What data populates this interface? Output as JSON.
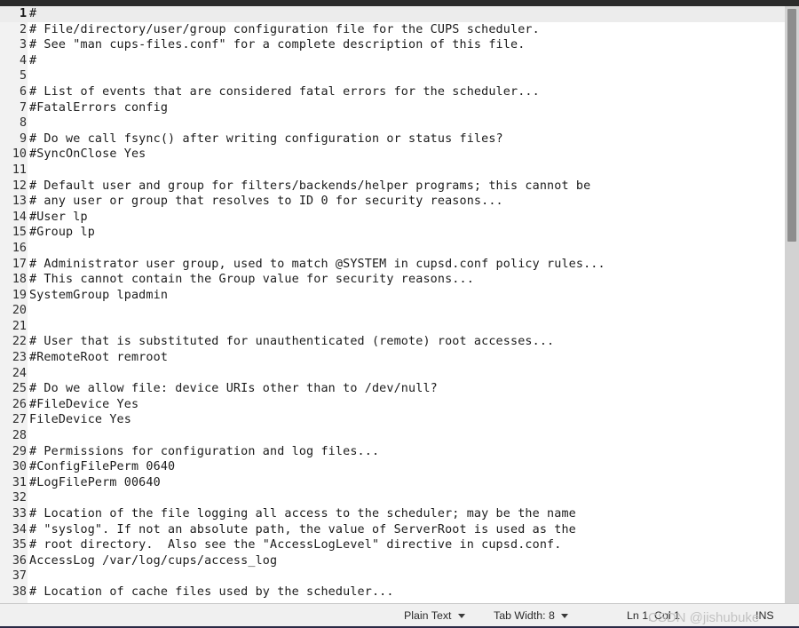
{
  "editor": {
    "current_line": 1,
    "lines": [
      {
        "n": "1",
        "text": "#"
      },
      {
        "n": "2",
        "text": "# File/directory/user/group configuration file for the CUPS scheduler."
      },
      {
        "n": "3",
        "text": "# See \"man cups-files.conf\" for a complete description of this file."
      },
      {
        "n": "4",
        "text": "#"
      },
      {
        "n": "5",
        "text": ""
      },
      {
        "n": "6",
        "text": "# List of events that are considered fatal errors for the scheduler..."
      },
      {
        "n": "7",
        "text": "#FatalErrors config"
      },
      {
        "n": "8",
        "text": ""
      },
      {
        "n": "9",
        "text": "# Do we call fsync() after writing configuration or status files?"
      },
      {
        "n": "10",
        "text": "#SyncOnClose Yes"
      },
      {
        "n": "11",
        "text": ""
      },
      {
        "n": "12",
        "text": "# Default user and group for filters/backends/helper programs; this cannot be"
      },
      {
        "n": "13",
        "text": "# any user or group that resolves to ID 0 for security reasons..."
      },
      {
        "n": "14",
        "text": "#User lp"
      },
      {
        "n": "15",
        "text": "#Group lp"
      },
      {
        "n": "16",
        "text": ""
      },
      {
        "n": "17",
        "text": "# Administrator user group, used to match @SYSTEM in cupsd.conf policy rules..."
      },
      {
        "n": "18",
        "text": "# This cannot contain the Group value for security reasons..."
      },
      {
        "n": "19",
        "text": "SystemGroup lpadmin"
      },
      {
        "n": "20",
        "text": ""
      },
      {
        "n": "21",
        "text": ""
      },
      {
        "n": "22",
        "text": "# User that is substituted for unauthenticated (remote) root accesses..."
      },
      {
        "n": "23",
        "text": "#RemoteRoot remroot"
      },
      {
        "n": "24",
        "text": ""
      },
      {
        "n": "25",
        "text": "# Do we allow file: device URIs other than to /dev/null?"
      },
      {
        "n": "26",
        "text": "#FileDevice Yes"
      },
      {
        "n": "27",
        "text": "FileDevice Yes"
      },
      {
        "n": "28",
        "text": ""
      },
      {
        "n": "29",
        "text": "# Permissions for configuration and log files..."
      },
      {
        "n": "30",
        "text": "#ConfigFilePerm 0640"
      },
      {
        "n": "31",
        "text": "#LogFilePerm 00640"
      },
      {
        "n": "32",
        "text": ""
      },
      {
        "n": "33",
        "text": "# Location of the file logging all access to the scheduler; may be the name"
      },
      {
        "n": "34",
        "text": "# \"syslog\". If not an absolute path, the value of ServerRoot is used as the"
      },
      {
        "n": "35",
        "text": "# root directory.  Also see the \"AccessLogLevel\" directive in cupsd.conf."
      },
      {
        "n": "36",
        "text": "AccessLog /var/log/cups/access_log"
      },
      {
        "n": "37",
        "text": ""
      },
      {
        "n": "38",
        "text": "# Location of cache files used by the scheduler..."
      }
    ]
  },
  "statusbar": {
    "language": "Plain Text",
    "tab_width": "Tab Width: 8",
    "position": "Ln 1, Col 1",
    "insert_mode": "INS"
  },
  "watermark": {
    "text": "CSDN @jishubuke"
  },
  "colors": {
    "top_strip": "#2b2b2b",
    "gutter": "#f2f2f2",
    "current_line": "#ececec",
    "scrollbar_track": "#d2d2d2",
    "scrollbar_thumb": "#8d8d8d",
    "statusbar": "#f0f0f0",
    "text": "#1b1b1b"
  }
}
